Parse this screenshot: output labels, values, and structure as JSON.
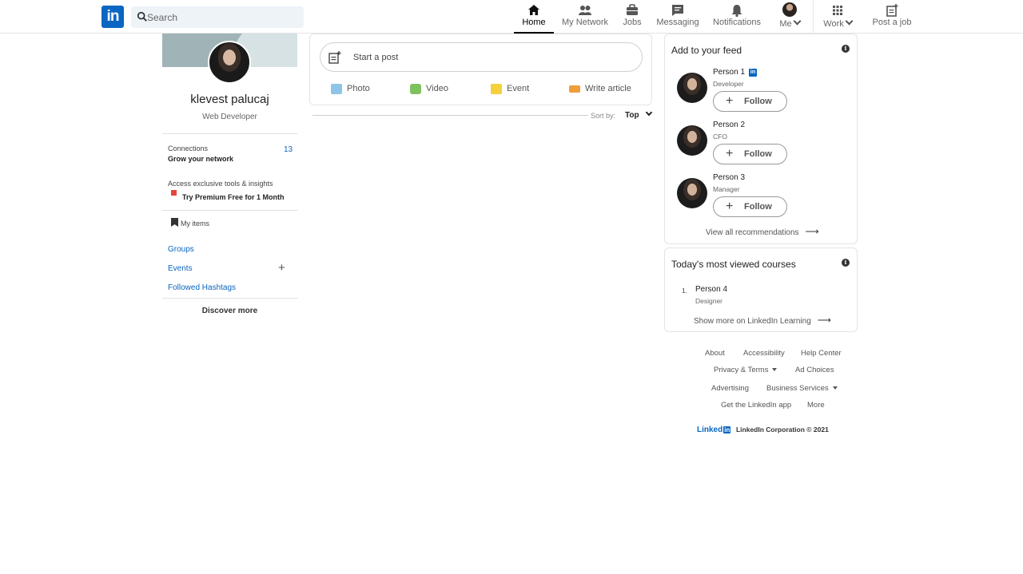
{
  "app": {
    "logo_text": "in",
    "brand_color": "#0a66c2"
  },
  "search": {
    "placeholder": "Search"
  },
  "nav": {
    "home": "Home",
    "network": "My Network",
    "jobs": "Jobs",
    "messaging": "Messaging",
    "notifications": "Notifications",
    "me": "Me",
    "work": "Work",
    "post_job": "Post a job"
  },
  "profile": {
    "name": "klevest palucaj",
    "title": "Web Developer",
    "connections_label": "Connections",
    "connections_sub": "Grow your network",
    "connections_count": "13",
    "premium_label": "Access exclusive tools & insights",
    "premium_cta": "Try Premium Free for 1 Month",
    "my_items": "My items",
    "groups": "Groups",
    "events": "Events",
    "hashtags": "Followed Hashtags",
    "discover": "Discover more"
  },
  "composer": {
    "placeholder": "Start a post",
    "photo": "Photo",
    "video": "Video",
    "event": "Event",
    "article": "Write article",
    "sort_label": "Sort by:",
    "sort_value": "Top"
  },
  "feed_suggestions": {
    "title": "Add to your feed",
    "people": [
      {
        "name": "Person 1",
        "role": "Developer",
        "follow": "Follow"
      },
      {
        "name": "Person 2",
        "role": "CFO",
        "follow": "Follow"
      },
      {
        "name": "Person 3",
        "role": "Manager",
        "follow": "Follow"
      }
    ],
    "view_all": "View all recommendations"
  },
  "courses": {
    "title": "Today's most viewed courses",
    "items": [
      {
        "rank": "1.",
        "name": "Person 4",
        "role": "Designer"
      }
    ],
    "show_more": "Show more on LinkedIn Learning"
  },
  "footer": {
    "about": "About",
    "accessibility": "Accessibility",
    "help": "Help Center",
    "privacy": "Privacy & Terms",
    "ad_choices": "Ad Choices",
    "advertising": "Advertising",
    "business": "Business Services",
    "app": "Get the LinkedIn app",
    "more": "More",
    "brand": "Linked",
    "brand_in": "in",
    "copyright": "LinkedIn Corporation © 2021"
  }
}
